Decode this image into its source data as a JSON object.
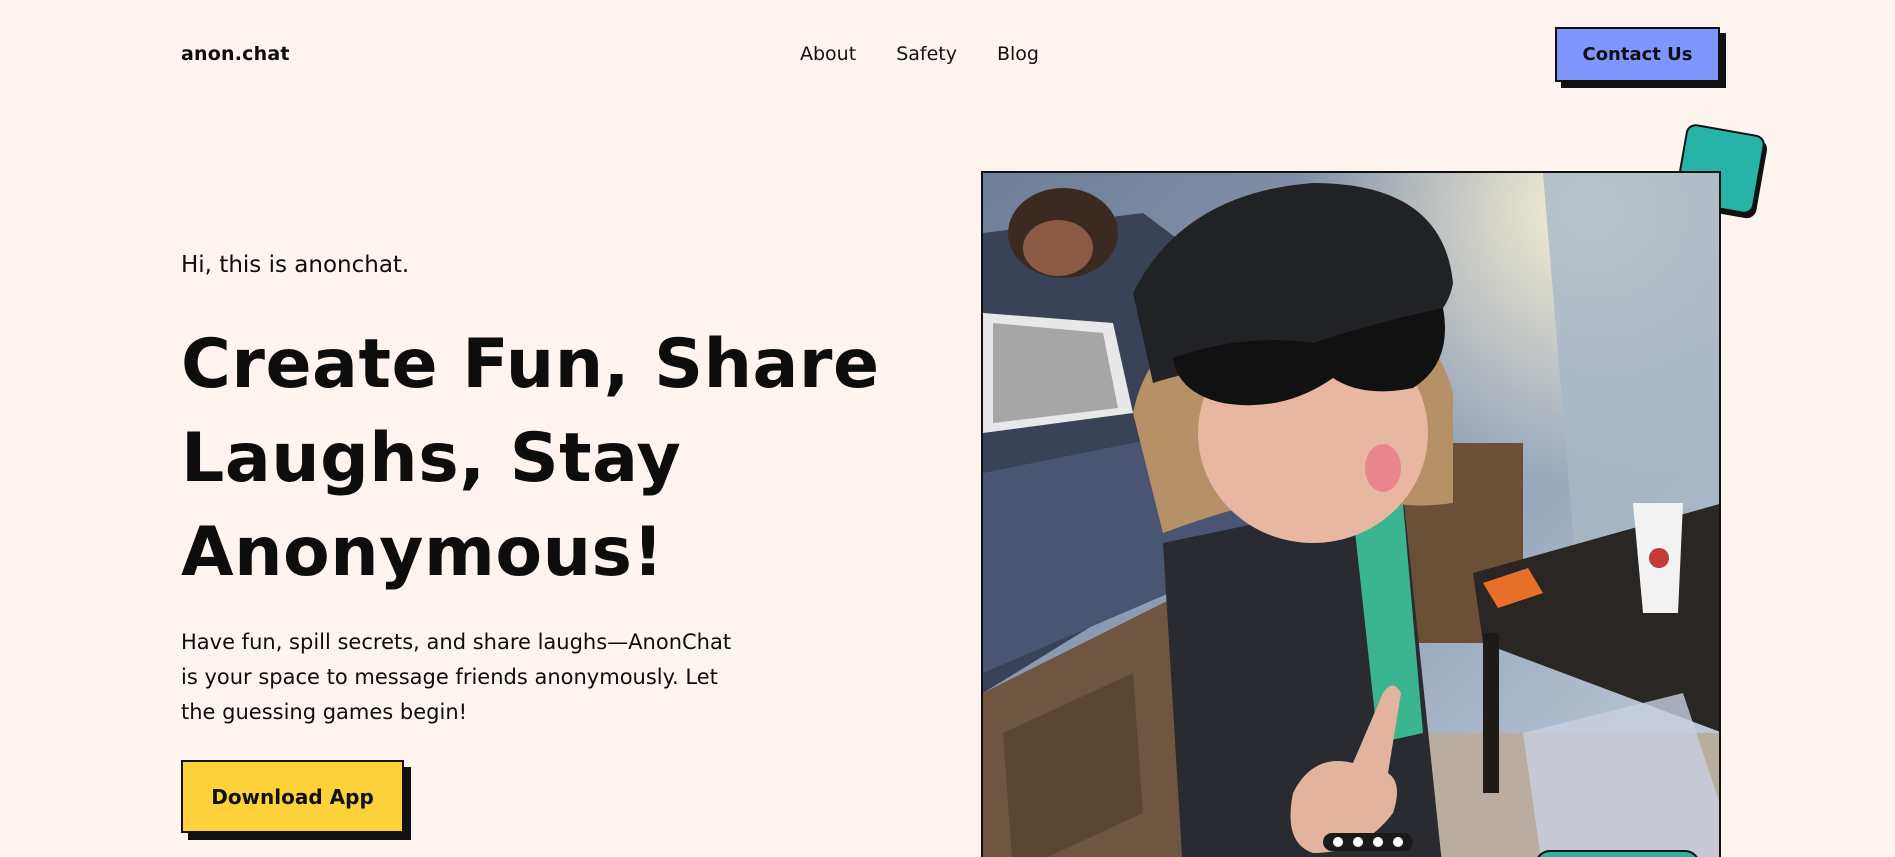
{
  "header": {
    "logo": "anon.chat",
    "nav": [
      "About",
      "Safety",
      "Blog"
    ],
    "contact_label": "Contact Us"
  },
  "hero": {
    "greeting": "Hi, this is anonchat.",
    "headline_lines": [
      "Create Fun, Share",
      "Laughs, Stay",
      "Anonymous!"
    ],
    "description": "Have fun, spill secrets, and share laughs—AnonChat is your space to message friends anonymously. Let the guessing games begin!",
    "download_label": "Download App"
  },
  "colors": {
    "background": "#FDF4F0",
    "contact_button": "#7F96FF",
    "download_button": "#FDD13A",
    "accent_teal": "#27B3A8"
  }
}
